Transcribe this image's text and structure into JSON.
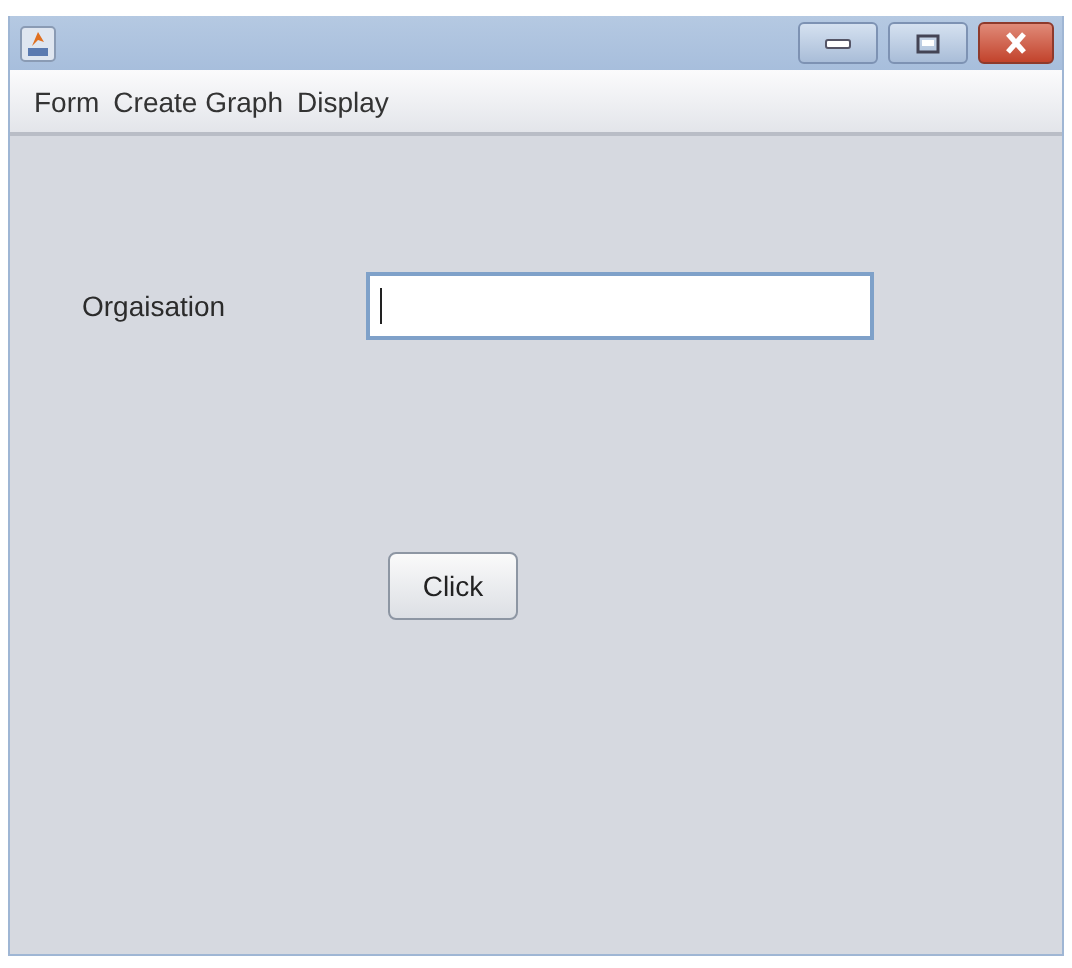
{
  "menu": [
    "Form",
    "Create Graph",
    "Display"
  ],
  "form": {
    "label": "Orgaisation",
    "button": "Click"
  }
}
